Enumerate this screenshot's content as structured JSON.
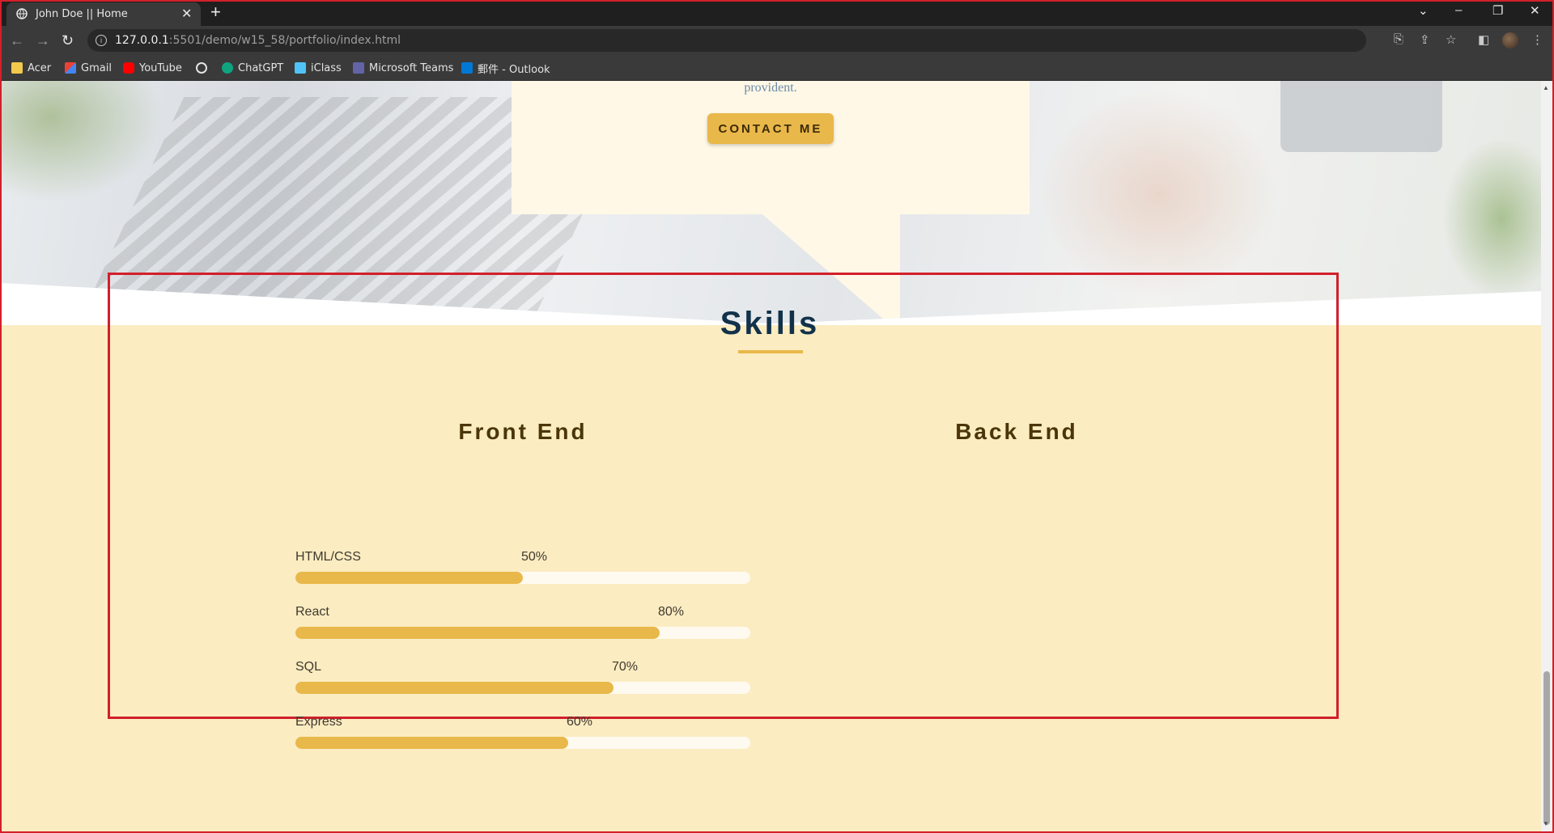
{
  "browser": {
    "tab_title": "John Doe || Home",
    "url_host": "127.0.0.1",
    "url_rest": ":5501/demo/w15_58/portfolio/index.html",
    "bookmarks": [
      {
        "label": "Acer",
        "icon": "folder-icon",
        "color": "#f2c94c"
      },
      {
        "label": "Gmail",
        "icon": "gmail-icon",
        "color": "#ea4335"
      },
      {
        "label": "YouTube",
        "icon": "youtube-icon",
        "color": "#ff0000"
      },
      {
        "label": "",
        "icon": "globe-icon",
        "color": "#e3e3e3"
      },
      {
        "label": "ChatGPT",
        "icon": "chatgpt-icon",
        "color": "#10a37f"
      },
      {
        "label": "iClass",
        "icon": "iclass-icon",
        "color": "#4fc3f7"
      },
      {
        "label": "Microsoft Teams",
        "icon": "teams-icon",
        "color": "#6264a7"
      },
      {
        "label": "郵件 - Outlook",
        "icon": "outlook-icon",
        "color": "#0078d4"
      }
    ]
  },
  "hero": {
    "partial_text": "provident.",
    "contact_label": "CONTACT ME"
  },
  "skills": {
    "title": "Skills",
    "front_end": {
      "title": "Front End",
      "items": [
        {
          "name": "HTML/CSS",
          "percent_label": "50%",
          "value": 50
        },
        {
          "name": "React",
          "percent_label": "80%",
          "value": 80
        },
        {
          "name": "SQL",
          "percent_label": "70%",
          "value": 70
        },
        {
          "name": "Express",
          "percent_label": "60%",
          "value": 60
        }
      ]
    },
    "back_end": {
      "title": "Back End",
      "items": []
    }
  },
  "colors": {
    "accent": "#e9b84a",
    "section_bg": "#fbecc1",
    "highlight_border": "#d21f2b",
    "title_color": "#12324a"
  }
}
